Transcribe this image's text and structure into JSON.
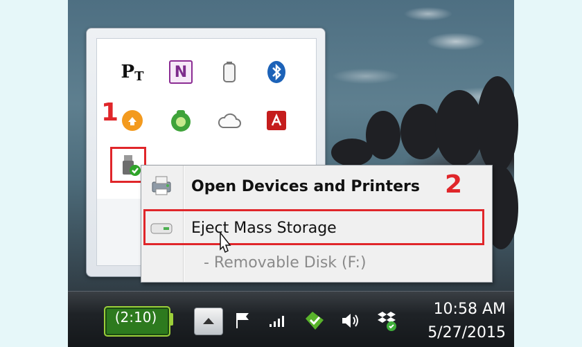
{
  "annotations": {
    "step1": "1",
    "step2": "2"
  },
  "tray": {
    "icons": [
      "pt-icon",
      "onenote-icon",
      "battery-outline-icon",
      "bluetooth-icon",
      "orange-upload-icon",
      "green-recycle-icon",
      "cloud-icon",
      "adobe-icon",
      "usb-safely-remove-icon",
      "red-app-icon",
      "network-drive-icon"
    ],
    "pt_label": "P",
    "pt_sub": "T",
    "onenote_label": "N"
  },
  "context_menu": {
    "open_devices": "Open Devices and Printers",
    "eject": "Eject Mass Storage",
    "removable_disk": "-   Removable Disk (F:)"
  },
  "taskbar": {
    "battery": "(2:10)",
    "time": "10:58 AM",
    "date": "5/27/2015"
  },
  "colors": {
    "highlight": "#e0262a",
    "battery_green": "#2d7a1e"
  }
}
